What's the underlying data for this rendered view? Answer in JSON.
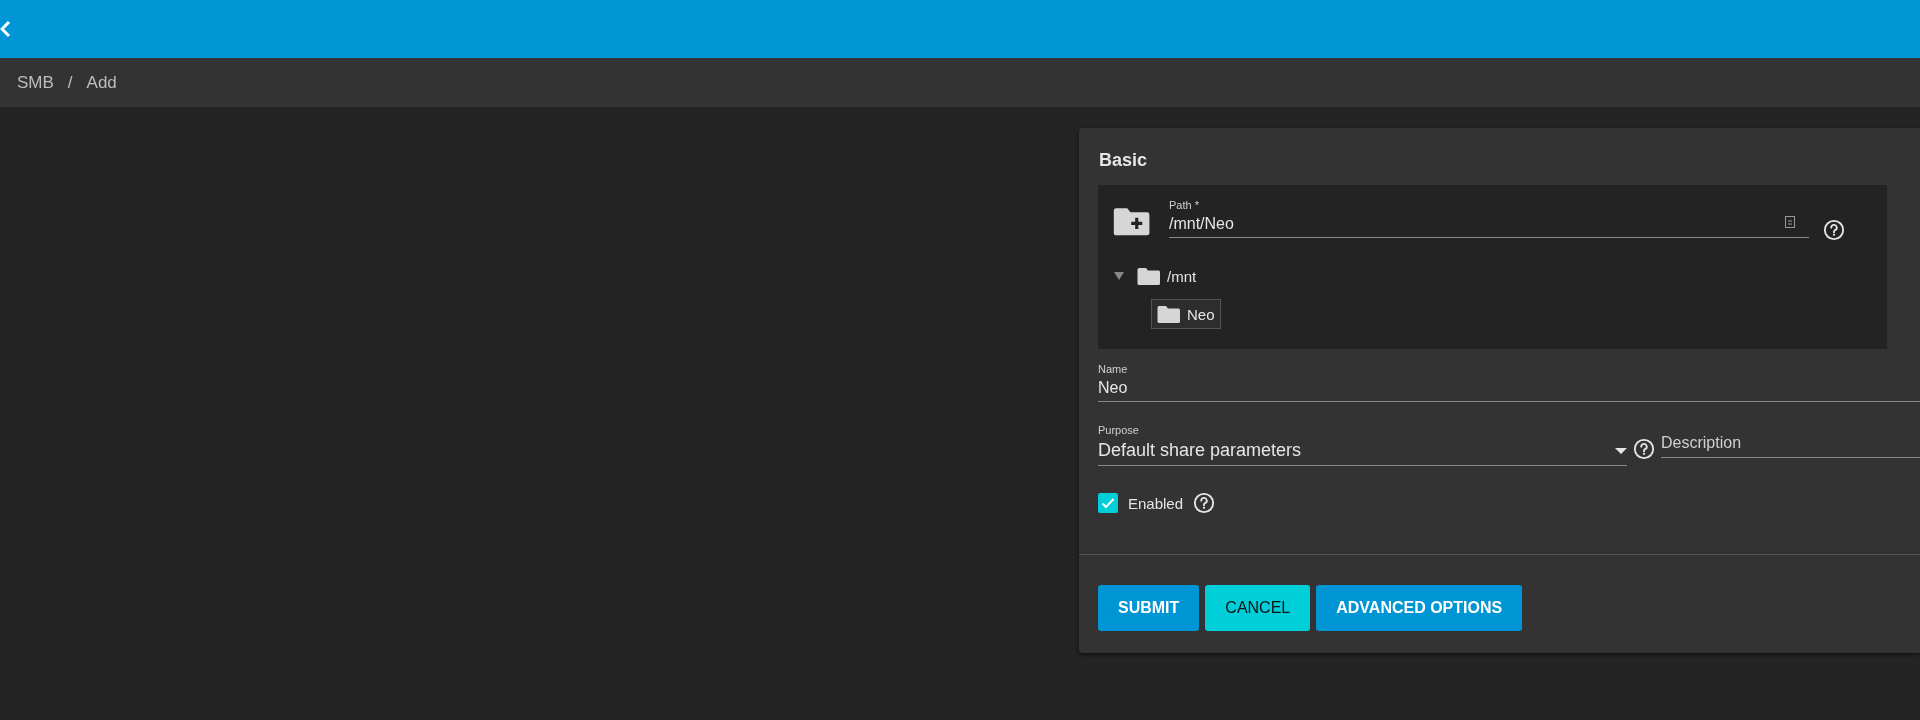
{
  "breadcrumb": {
    "items": [
      "SMB",
      "Add"
    ],
    "separator": "/"
  },
  "form": {
    "title": "Basic",
    "path": {
      "label": "Path *",
      "value": "/mnt/Neo",
      "tree": [
        {
          "label": "/mnt",
          "expanded": true,
          "selected": false,
          "children": [
            {
              "label": "Neo",
              "selected": true
            }
          ]
        }
      ]
    },
    "name": {
      "label": "Name",
      "value": "Neo"
    },
    "purpose": {
      "label": "Purpose",
      "value": "Default share parameters"
    },
    "description": {
      "placeholder": "Description"
    },
    "enabled": {
      "label": "Enabled",
      "checked": true
    },
    "buttons": [
      {
        "label": "SUBMIT",
        "kind": "primary"
      },
      {
        "label": "CANCEL",
        "kind": "accent"
      },
      {
        "label": "ADVANCED OPTIONS",
        "kind": "primary"
      }
    ]
  }
}
